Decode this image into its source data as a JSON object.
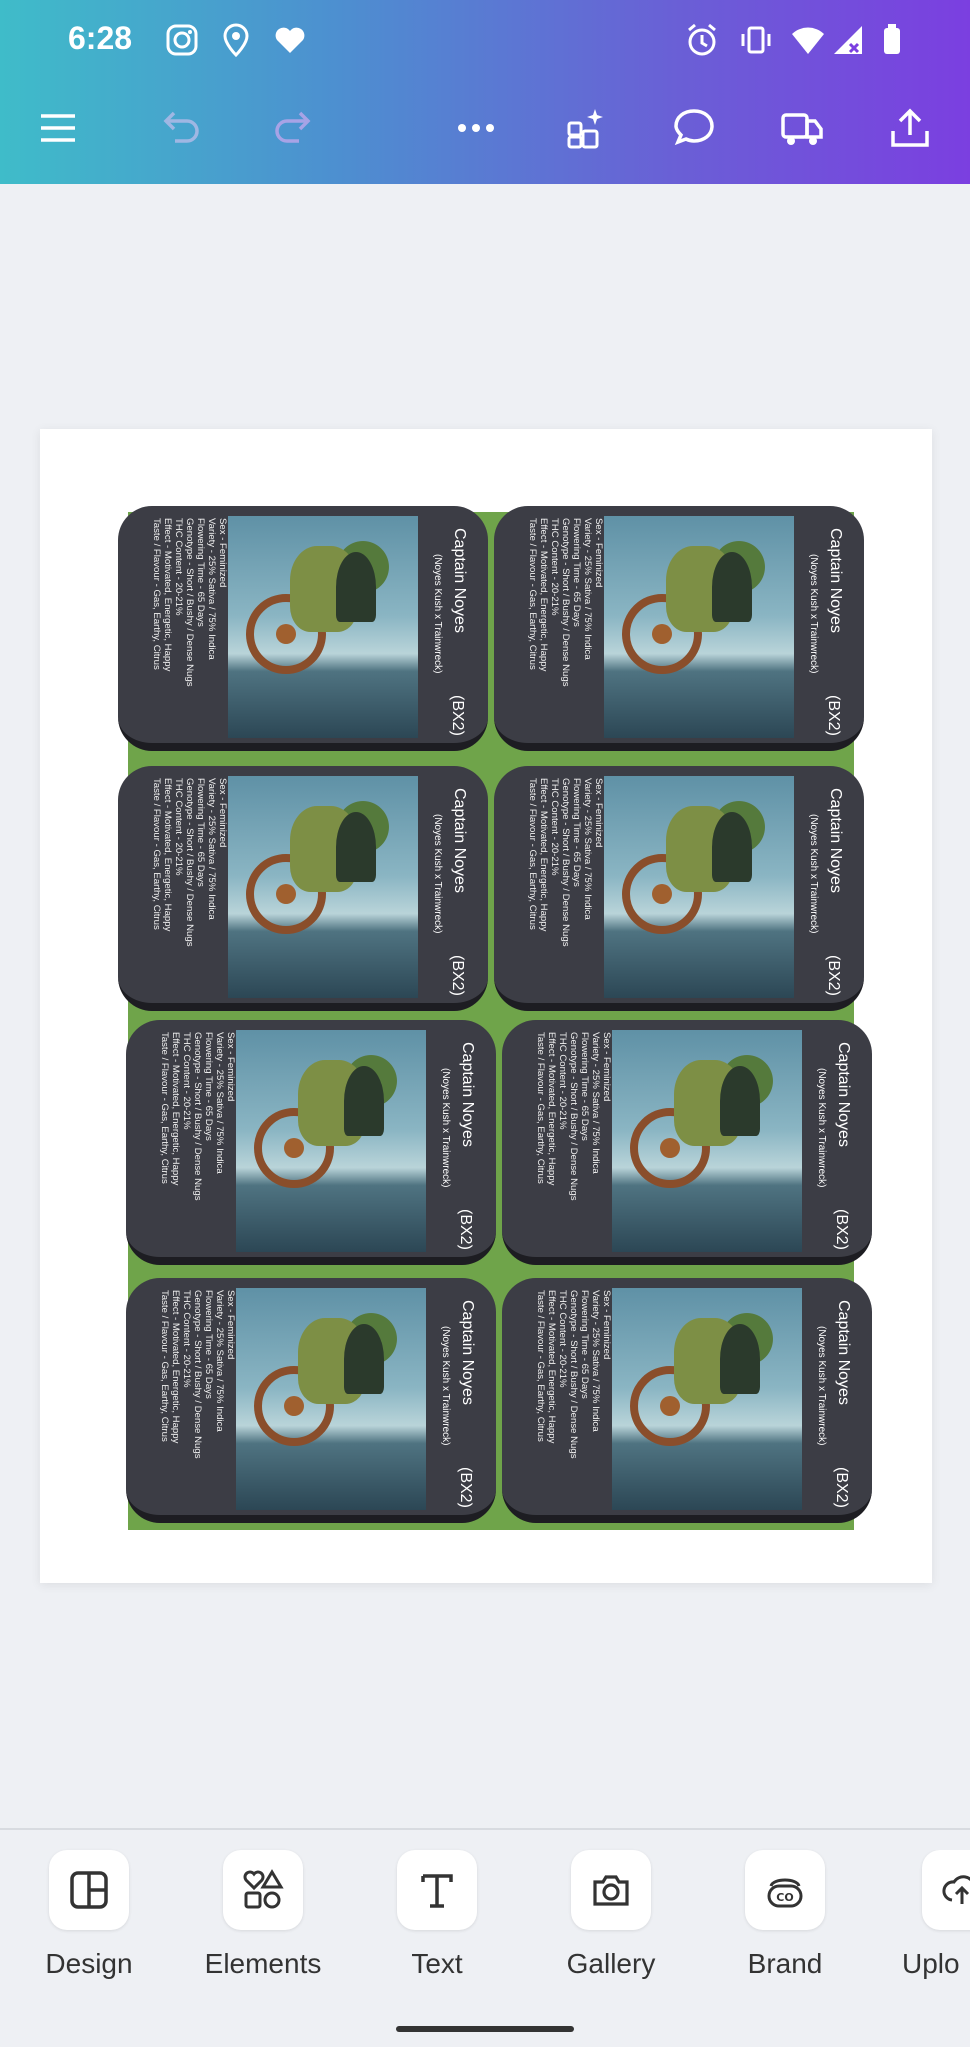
{
  "status_bar": {
    "time": "6:28",
    "icons": [
      "instagram-icon",
      "location-pin-icon",
      "heart-icon",
      "alarm-icon",
      "vibrate-icon",
      "wifi-icon",
      "signal-icon",
      "battery-icon"
    ]
  },
  "toolbar": {
    "menu_icon": "menu-icon",
    "undo_icon": "undo-icon",
    "redo_icon": "redo-icon",
    "more_icon": "more-icon",
    "magic_icon": "magic-icon",
    "comment_icon": "comment-icon",
    "print_icon": "truck-icon",
    "share_icon": "share-icon"
  },
  "card": {
    "name": "Captain Noyes",
    "cross": "(Noyes Kush x Trainwreck)",
    "bx": "(BX2)",
    "stats": [
      "Sex - Feminized",
      "Variety - 25% Sativa / 75% Indica",
      "Flowering Time - 65 Days",
      "Genotype - Short / Bushy / Dense Nugs",
      "THC Content - 20-21%",
      "Effect - Motivated, Energetic, Happy",
      "Taste / Flavour - Gas, Earthy, Citrus"
    ]
  },
  "bottom_nav": [
    {
      "label": "Design",
      "icon": "design-icon"
    },
    {
      "label": "Elements",
      "icon": "elements-icon"
    },
    {
      "label": "Text",
      "icon": "text-icon"
    },
    {
      "label": "Gallery",
      "icon": "camera-icon"
    },
    {
      "label": "Brand",
      "icon": "brand-icon"
    },
    {
      "label": "Uplo",
      "icon": "upload-icon"
    }
  ],
  "colors": {
    "gradient_start": "#3fbcc9",
    "gradient_end": "#7b3fe0",
    "sheet_green": "#6fa44a",
    "card_dark": "#3c3d45"
  }
}
